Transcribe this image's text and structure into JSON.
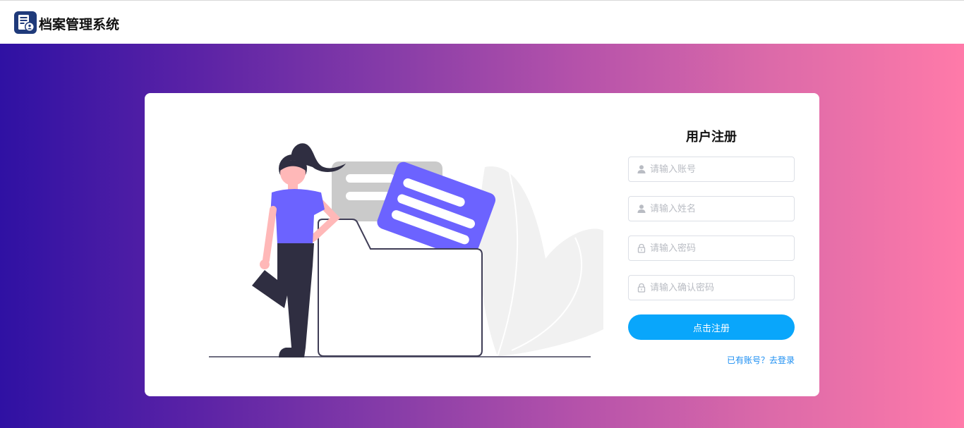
{
  "app": {
    "title": "档案管理系统",
    "logo_icon": "archive-logo-icon"
  },
  "register": {
    "title": "用户注册",
    "fields": [
      {
        "placeholder": "请输入账号",
        "value": "",
        "icon": "user-icon"
      },
      {
        "placeholder": "请输入姓名",
        "value": "",
        "icon": "user-icon"
      },
      {
        "placeholder": "请输入密码",
        "value": "",
        "icon": "lock-icon"
      },
      {
        "placeholder": "请输入确认密码",
        "value": "",
        "icon": "lock-icon"
      }
    ],
    "submit_label": "点击注册",
    "login_link": "已有账号？去登录"
  },
  "colors": {
    "gradient_start": "#2f11a3",
    "gradient_end": "#ff7aa9",
    "primary_button": "#09a6fb",
    "link": "#1b8ef2",
    "logo": "#1f3a7a"
  }
}
